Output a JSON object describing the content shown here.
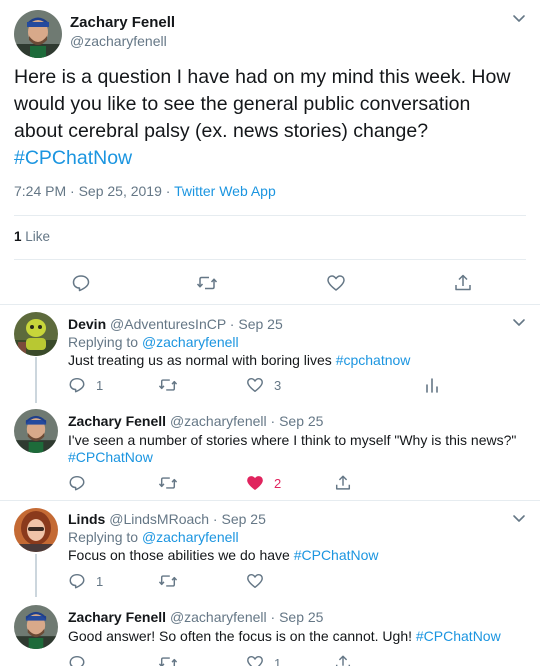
{
  "main_tweet": {
    "author_name": "Zachary Fenell",
    "author_handle": "@zacharyfenell",
    "text": "Here is a question I have had on my mind this week. How would you like to see the general public conversation about cerebral palsy (ex. news stories) change?",
    "hashtag": "#CPChatNow",
    "timestamp": "7:24 PM · Sep 25, 2019 · ",
    "app": "Twitter Web App",
    "likes_count": "1",
    "likes_label": " Like"
  },
  "replies": [
    {
      "name": "Devin",
      "handle": "@AdventuresInCP",
      "date": " · Sep 25",
      "replying_label": "Replying to ",
      "replying_to": "@zacharyfenell",
      "text": "Just treating us as normal with boring lives ",
      "hashtag": "#cpchatnow",
      "reply_count": "1",
      "retweet_count": "",
      "like_count": "3"
    },
    {
      "name": "Zachary Fenell",
      "handle": "@zacharyfenell",
      "date": " · Sep 25",
      "text": "I've seen a number of stories where I think to myself \"Why is this news?\"",
      "hashtag": "#CPChatNow",
      "reply_count": "",
      "retweet_count": "",
      "like_count": "2"
    },
    {
      "name": "Linds",
      "handle": "@LindsMRoach",
      "date": " · Sep 25",
      "replying_label": "Replying to ",
      "replying_to": "@zacharyfenell",
      "text": "Focus on those abilities we do have ",
      "hashtag": "#CPChatNow",
      "reply_count": "1",
      "retweet_count": "",
      "like_count": ""
    },
    {
      "name": "Zachary Fenell",
      "handle": "@zacharyfenell",
      "date": " · Sep 25",
      "text": "Good answer! So often the focus is on the cannot. Ugh! ",
      "hashtag": "#CPChatNow",
      "reply_count": "",
      "retweet_count": "",
      "like_count": "1"
    }
  ],
  "icons": {
    "reply": "reply-icon",
    "retweet": "retweet-icon",
    "like": "heart-icon",
    "share": "share-icon",
    "analytics": "analytics-icon",
    "menu": "chevron-down-icon"
  },
  "colors": {
    "link": "#1b95e0",
    "secondary": "#657786",
    "liked": "#e0245e"
  }
}
